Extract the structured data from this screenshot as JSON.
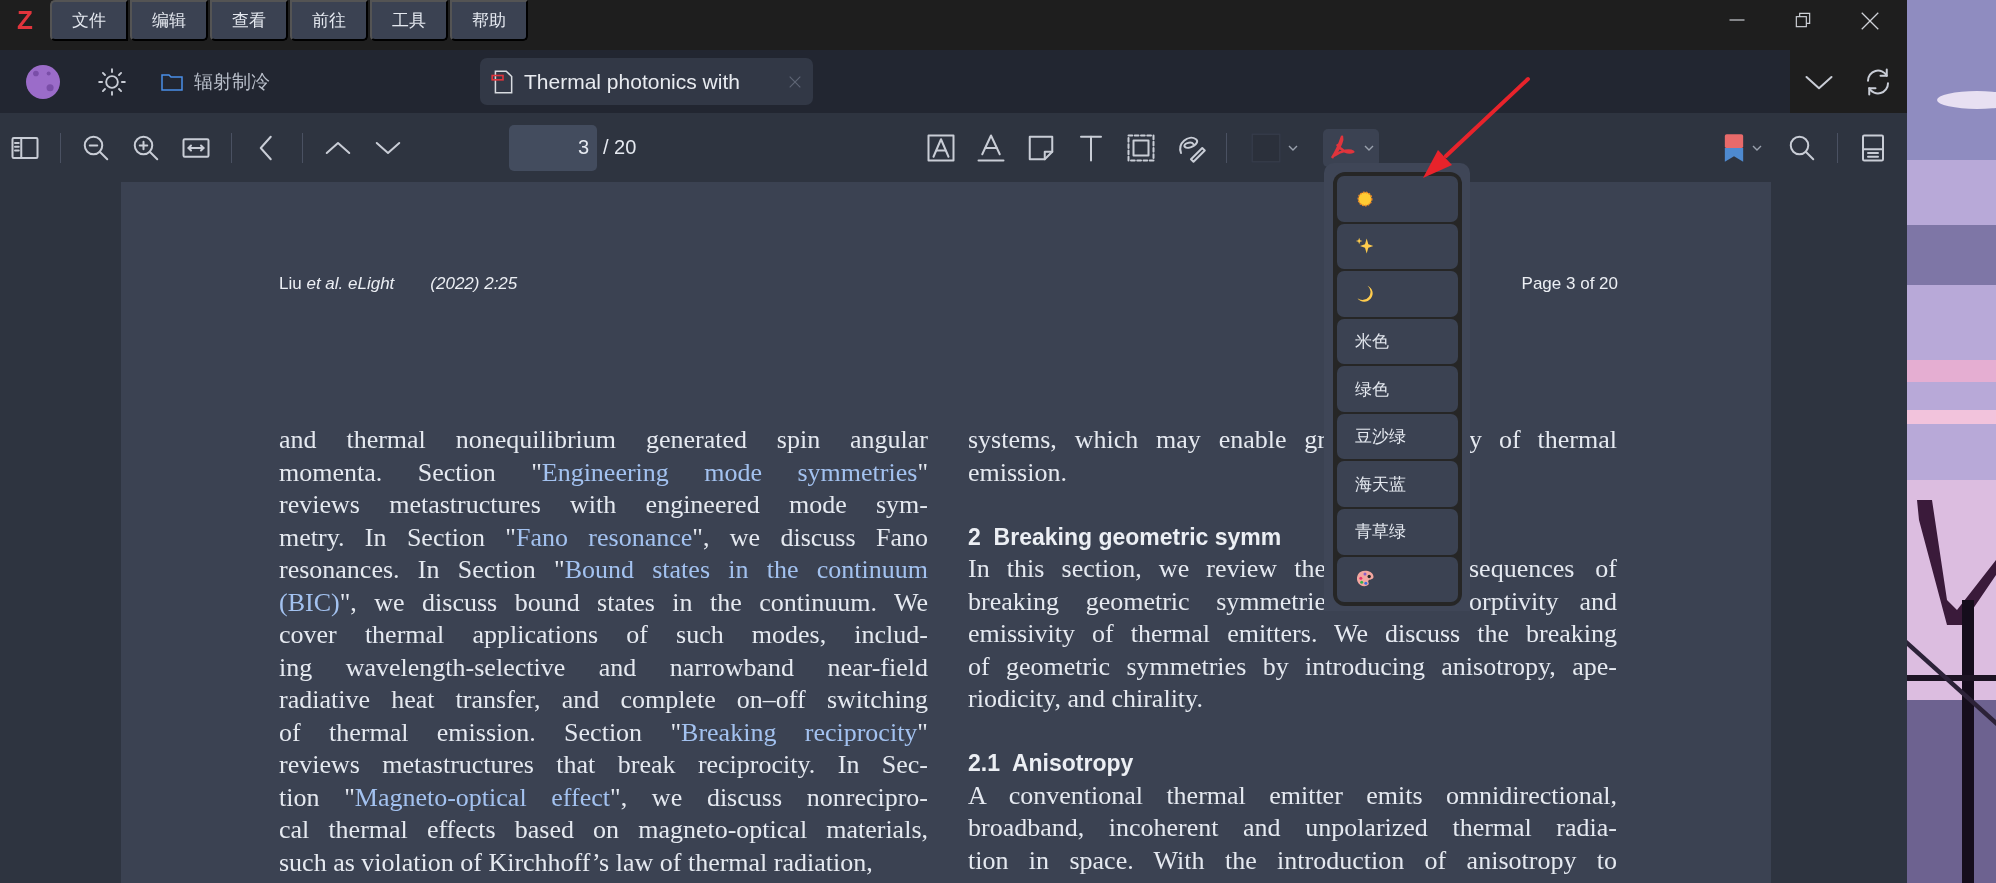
{
  "app_logo": "Z",
  "menubar": [
    {
      "label": "文件"
    },
    {
      "label": "编辑"
    },
    {
      "label": "查看"
    },
    {
      "label": "前往"
    },
    {
      "label": "工具"
    },
    {
      "label": "帮助"
    }
  ],
  "tabs": [
    {
      "kind": "folder",
      "label": "辐射制冷",
      "selected": false
    },
    {
      "kind": "pdf",
      "label": "Thermal photonics with",
      "selected": true
    }
  ],
  "toolbar": {
    "page_number": "3",
    "page_total": "/ 20",
    "appearance_menu_expanded": true
  },
  "appearance_menu": [
    {
      "kind": "sun"
    },
    {
      "kind": "sparkles"
    },
    {
      "kind": "moon"
    },
    {
      "kind": "label",
      "label": "米色"
    },
    {
      "kind": "label",
      "label": "绿色"
    },
    {
      "kind": "label",
      "label": "豆沙绿"
    },
    {
      "kind": "label",
      "label": "海天蓝"
    },
    {
      "kind": "label",
      "label": "青草绿"
    },
    {
      "kind": "palette"
    }
  ],
  "page": {
    "header_left": "Liu *et al. eLight*",
    "header_journal": "(2022) 2:25",
    "header_right": "Page 3 of 20",
    "left_column": [
      [
        {
          "text": "and thermal nonequilibrium generated spin angular",
          "link": false
        }
      ],
      [
        {
          "text": "momenta. Section \"",
          "link": false
        },
        {
          "text": "Engineering mode symmetries",
          "link": true
        },
        {
          "text": "\"",
          "link": false
        }
      ],
      [
        {
          "text": "reviews metastructures with engineered mode sym-",
          "link": false
        }
      ],
      [
        {
          "text": "metry. In Section \"",
          "link": false
        },
        {
          "text": "Fano resonance",
          "link": true
        },
        {
          "text": "\", we discuss Fano",
          "link": false
        }
      ],
      [
        {
          "text": "resonances. In Section \"",
          "link": false
        },
        {
          "text": "Bound states in the continuum",
          "link": true
        }
      ],
      [
        {
          "text": "(BIC)",
          "link": true
        },
        {
          "text": "\", we discuss bound states in the continuum. We",
          "link": false
        }
      ],
      [
        {
          "text": "cover thermal applications of such modes, includ-",
          "link": false
        }
      ],
      [
        {
          "text": "ing wavelength-selective and narrowband near-field",
          "link": false
        }
      ],
      [
        {
          "text": "radiative heat transfer, and complete on–off switching",
          "link": false
        }
      ],
      [
        {
          "text": "of thermal emission. Section \"",
          "link": false
        },
        {
          "text": "Breaking reciprocity",
          "link": true
        },
        {
          "text": "\"",
          "link": false
        }
      ],
      [
        {
          "text": "reviews metastructures that break reciprocity. In Sec-",
          "link": false
        }
      ],
      [
        {
          "text": "tion \"",
          "link": false
        },
        {
          "text": "Magneto-optical effect",
          "link": true
        },
        {
          "text": "\", we discuss nonrecipro-",
          "link": false
        }
      ],
      [
        {
          "text": "cal thermal effects based on magneto-optical materials,",
          "link": false
        }
      ],
      [
        {
          "text": "such as violation of Kirchhoff’s law of thermal radiation,",
          "link": false
        }
      ]
    ],
    "right_column": [
      {
        "kind": "split",
        "left": "systems, which may enable gr",
        "right": "y of thermal"
      },
      {
        "kind": "end",
        "text": "emission."
      },
      {
        "kind": "heading",
        "text": "2  Breaking geometric symm"
      },
      {
        "kind": "split",
        "left": "In this section, we review the",
        "right": "sequences of"
      },
      {
        "kind": "split",
        "left": "breaking geometric symmetrie",
        "right": "orptivity and"
      },
      {
        "kind": "full",
        "text": "emissivity of thermal emitters. We discuss the breaking"
      },
      {
        "kind": "full",
        "text": "of geometric symmetries by introducing anisotropy, ape-"
      },
      {
        "kind": "end",
        "text": "riodicity, and chirality."
      },
      {
        "kind": "heading",
        "text": "2.1  Anisotropy"
      },
      {
        "kind": "full",
        "text": "A conventional thermal emitter emits omnidirectional,"
      },
      {
        "kind": "full",
        "text": "broadband, incoherent and unpolarized thermal radia-"
      },
      {
        "kind": "full",
        "text": "tion in space. With the introduction of anisotropy to"
      }
    ]
  }
}
